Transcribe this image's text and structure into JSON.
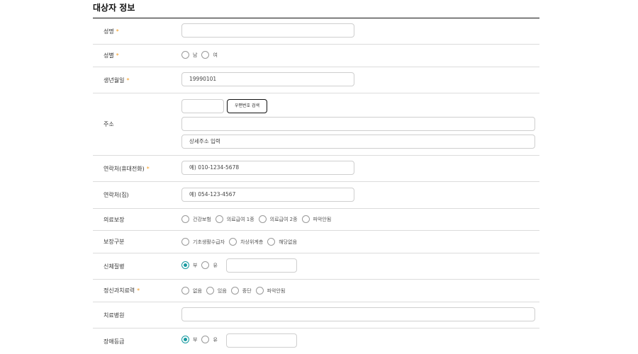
{
  "section": {
    "title": "대상자 정보"
  },
  "required_mark": "*",
  "fields": {
    "name": {
      "label": "성명",
      "value": ""
    },
    "gender": {
      "label": "성별",
      "options": [
        "남",
        "여"
      ]
    },
    "birth": {
      "label": "생년월일",
      "value": "19990101"
    },
    "address": {
      "label": "주소",
      "zip_value": "",
      "zip_search_button": "우편번호 검색",
      "address_value": "",
      "detail_placeholder": "상세주소 입력"
    },
    "mobile": {
      "label": "연락처(휴대전화)",
      "placeholder": "예) 010-1234-5678"
    },
    "home_phone": {
      "label": "연락처(집)",
      "placeholder": "예) 054-123-4567"
    },
    "insurance": {
      "label": "의료보장",
      "options": [
        "건강보험",
        "의료급여 1종",
        "의료급여 2종",
        "파악안됨"
      ]
    },
    "protection": {
      "label": "보장구분",
      "options": [
        "기초생활수급자",
        "차상위계층",
        "해당없음"
      ]
    },
    "physical_illness": {
      "label": "신체질병",
      "options": [
        "부",
        "유"
      ],
      "selected": "부",
      "detail_value": ""
    },
    "psych_history": {
      "label": "정신과치료력",
      "options": [
        "없음",
        "있음",
        "중단",
        "파악안됨"
      ]
    },
    "hospital": {
      "label": "치료병원",
      "value": ""
    },
    "disability": {
      "label": "장애등급",
      "options": [
        "부",
        "유"
      ],
      "selected": "부",
      "detail_value": ""
    }
  },
  "colors": {
    "accent": "#169aa0",
    "required": "#f39a1e",
    "border": "#cfcfcf"
  }
}
